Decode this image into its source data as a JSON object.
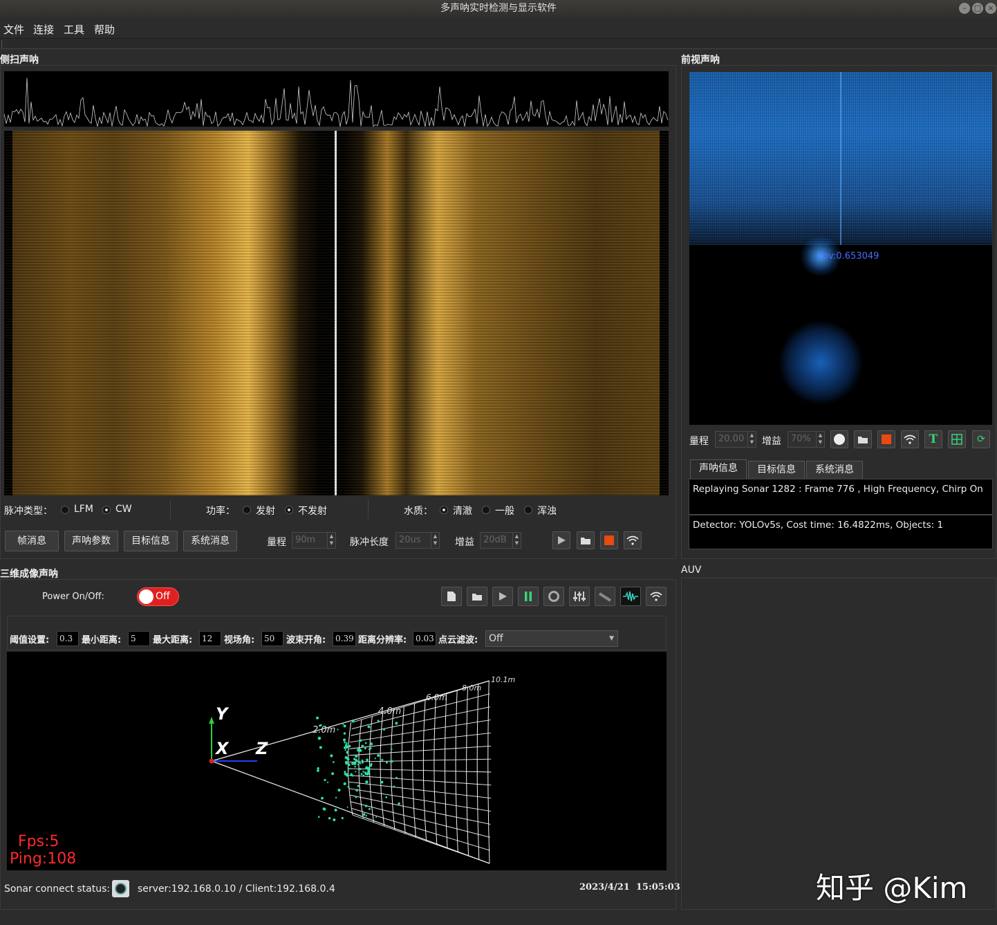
{
  "window": {
    "title": "多声呐实时检测与显示软件"
  },
  "menu": [
    "文件",
    "连接",
    "工具",
    "帮助"
  ],
  "sidescan": {
    "title": "侧扫声呐",
    "pulse_label": "脉冲类型：",
    "pulse_opts": [
      "LFM",
      "CW"
    ],
    "power_label": "功率：",
    "power_opts": [
      "发射",
      "不发射"
    ],
    "water_label": "水质：",
    "water_opts": [
      "清澈",
      "一般",
      "浑浊"
    ],
    "buttons": [
      "帧消息",
      "声呐参数",
      "目标信息",
      "系统消息"
    ],
    "range_label": "量程",
    "range_value": "90m",
    "pulse_len_label": "脉冲长度",
    "pulse_len_value": "20us",
    "gain_label": "增益",
    "gain_value": "20dB"
  },
  "forward": {
    "title": "前视声呐",
    "detection_label": "rov:0.653049",
    "range_label": "量程",
    "range_value": "20.00",
    "gain_label": "增益",
    "gain_value": "70%",
    "tabs": [
      "声呐信息",
      "目标信息",
      "系统消息"
    ],
    "info_line1": "Replaying Sonar 1282 : Frame 776 , High Frequency, Chirp On",
    "info_line2": "Detector: YOLOv5s, Cost time: 16.4822ms, Objects: 1"
  },
  "imaging3d": {
    "title": "三维成像声呐",
    "power_label": "Power On/Off:",
    "power_state": "Off",
    "threshold_label": "阈值设置:",
    "threshold": "0.3",
    "min_dist_label": "最小距离:",
    "min_dist": "5",
    "max_dist_label": "最大距离:",
    "max_dist": "12",
    "fov_label": "视场角:",
    "fov": "50",
    "beam_label": "波束开角:",
    "beam": "0.39",
    "res_label": "距离分辨率:",
    "res": "0.03",
    "filter_label": "点云滤波:",
    "filter": "Off",
    "axis_y": "Y",
    "axis_x": "X",
    "axis_z": "Z",
    "grid_labels": [
      "2.0m",
      "4.0m",
      "6.0m",
      "8.0m",
      "10.1m"
    ],
    "fps": "Fps:5",
    "ping": "Ping:108",
    "status_label": "Sonar connect status:",
    "status_value": "server:192.168.0.10 / Client:192.168.0.4",
    "datetime": "2023/4/21  15:05:03"
  },
  "auv": {
    "title": "AUV",
    "watermark": "知乎 @Kim"
  },
  "colors": {
    "sidescan": "#c8902a",
    "forward": "#1e88e5",
    "points": "#2de0a0",
    "hud": "#ff2a2a",
    "toggle": "#e02020"
  }
}
